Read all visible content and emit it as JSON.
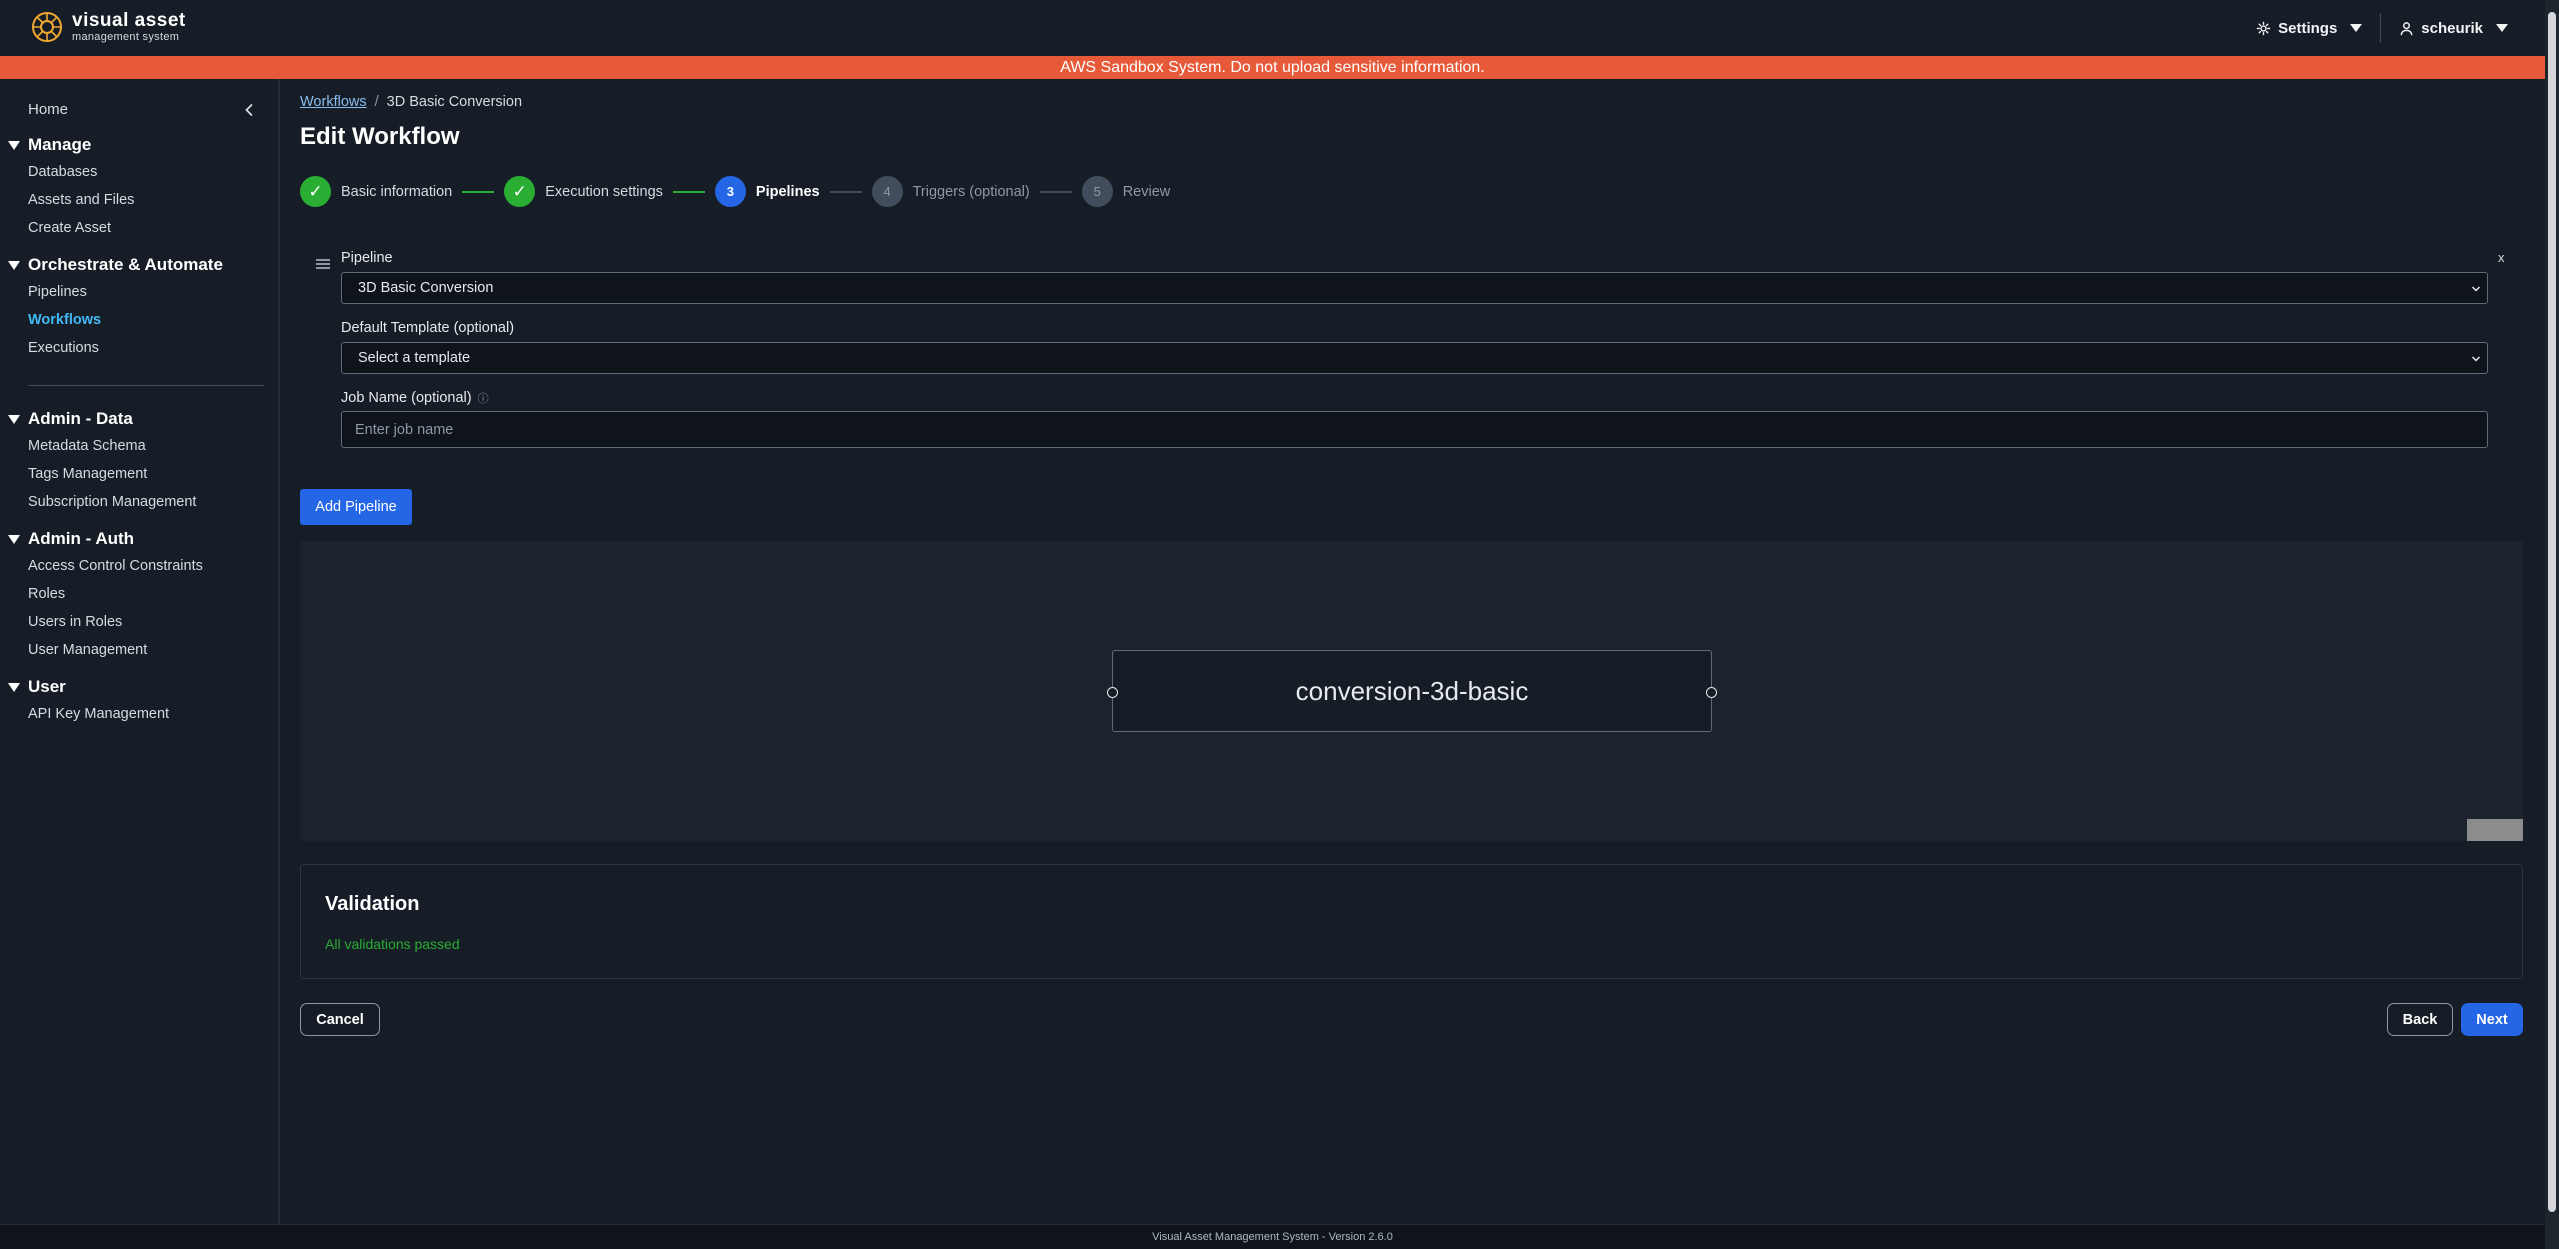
{
  "app": {
    "logo_title": "visual asset",
    "logo_subtitle": "management system"
  },
  "topnav": {
    "settings_label": "Settings",
    "user_label": "scheurik"
  },
  "banner": {
    "text": "AWS Sandbox System. Do not upload sensitive information."
  },
  "sidebar": {
    "home": "Home",
    "sections": [
      {
        "title": "Manage",
        "items": [
          "Databases",
          "Assets and Files",
          "Create Asset"
        ]
      },
      {
        "title": "Orchestrate & Automate",
        "items": [
          "Pipelines",
          "Workflows",
          "Executions"
        ]
      },
      {
        "title": "Admin - Data",
        "items": [
          "Metadata Schema",
          "Tags Management",
          "Subscription Management"
        ]
      },
      {
        "title": "Admin - Auth",
        "items": [
          "Access Control Constraints",
          "Roles",
          "Users in Roles",
          "User Management"
        ]
      },
      {
        "title": "User",
        "items": [
          "API Key Management"
        ]
      }
    ],
    "active_item": "Workflows"
  },
  "breadcrumb": {
    "parent": "Workflows",
    "separator": "/",
    "current": "3D Basic Conversion"
  },
  "page": {
    "title": "Edit Workflow"
  },
  "steps": [
    {
      "number": "1",
      "label": "Basic information",
      "state": "done"
    },
    {
      "number": "2",
      "label": "Execution settings",
      "state": "done"
    },
    {
      "number": "3",
      "label": "Pipelines",
      "state": "current"
    },
    {
      "number": "4",
      "label": "Triggers (optional)",
      "state": "todo"
    },
    {
      "number": "5",
      "label": "Review",
      "state": "todo"
    }
  ],
  "pipeline_form": {
    "pipeline_label": "Pipeline",
    "pipeline_value": "3D Basic Conversion",
    "template_label": "Default Template (optional)",
    "template_value": "Select a template",
    "job_name_label": "Job Name (optional)",
    "job_name_placeholder": "Enter job name",
    "job_name_value": "",
    "remove_label": "x",
    "add_pipeline_label": "Add Pipeline"
  },
  "canvas": {
    "node_label": "conversion-3d-basic"
  },
  "validation": {
    "title": "Validation",
    "message": "All validations passed"
  },
  "actions": {
    "cancel": "Cancel",
    "back": "Back",
    "next": "Next"
  },
  "footer": {
    "text": "Visual Asset Management System - Version 2.6.0"
  },
  "colors": {
    "background": "#161d26",
    "banner": "#e65a3a",
    "primary": "#2466e6",
    "success": "#29ad32",
    "link": "#44b9f6"
  }
}
